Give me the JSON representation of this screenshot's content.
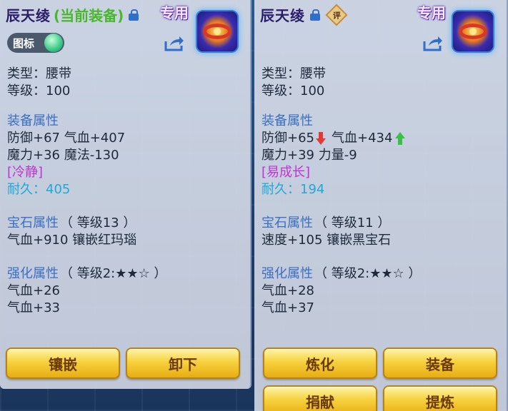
{
  "left": {
    "name": "辰天绫",
    "equipped_tag": "(当前装备)",
    "exclusive": "专用",
    "toggle_label": "图标",
    "type_line": "类型：腰带",
    "level_line": "等级：100",
    "equip_attr_title": "装备属性",
    "attr1": "防御+67 气血+407",
    "attr2": "魔力+36 魔法-130",
    "special": "[冷静]",
    "durability": "耐久：405",
    "gem_title": "宝石属性",
    "gem_level": "（ 等级13 ）",
    "gem_line": "气血+910 镶嵌红玛瑙",
    "enhance_title": "强化属性",
    "enhance_level": "（ 等级2:★★☆ ）",
    "enhance1": "气血+26",
    "enhance2": "气血+33",
    "buttons": [
      "镶嵌",
      "卸下"
    ]
  },
  "right": {
    "name": "辰天绫",
    "rate_icon": "评",
    "exclusive": "专用",
    "type_line": "类型：腰带",
    "level_line": "等级：100",
    "equip_attr_title": "装备属性",
    "attr_def": "防御+65",
    "attr_hp": "气血+434",
    "attr2": "魔力+39 力量-9",
    "special": "[易成长]",
    "durability": "耐久：194",
    "gem_title": "宝石属性",
    "gem_level": "（ 等级11 ）",
    "gem_line": "速度+105 镶嵌黑宝石",
    "enhance_title": "强化属性",
    "enhance_level": "（ 等级2:★★☆ ）",
    "enhance1": "气血+28",
    "enhance2": "气血+37",
    "buttons": [
      "炼化",
      "装备",
      "捐献",
      "提炼"
    ]
  },
  "colors": {
    "section_title": "#3b6fc4",
    "special_tag": "#c133d2",
    "durability": "#1fa8d8",
    "equipped_tag": "#48b82b",
    "stat_down": "#e23b35",
    "stat_up": "#39c046",
    "button": "#f6d23f"
  }
}
